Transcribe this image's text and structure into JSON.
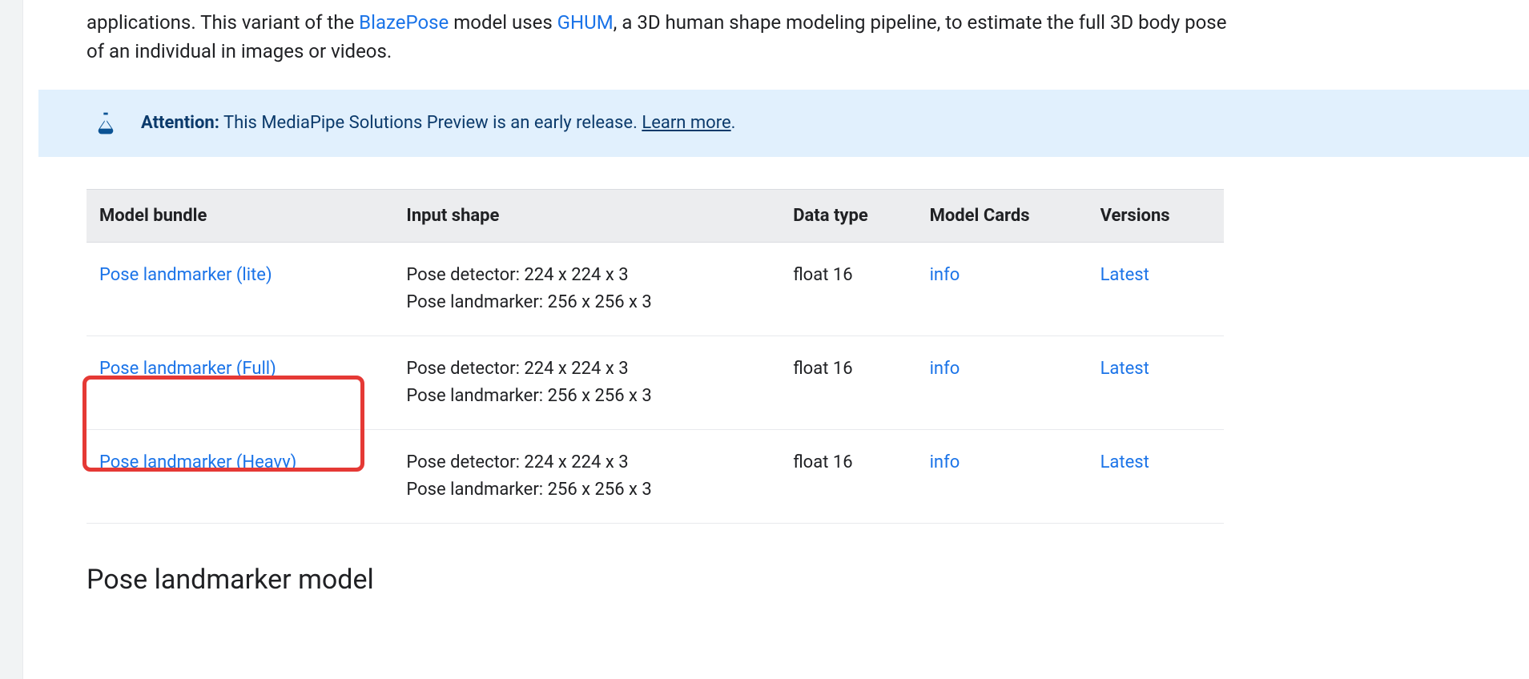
{
  "paragraph": {
    "seg1": "applications. This variant of the ",
    "link1": "BlazePose",
    "seg2": " model uses ",
    "link2": "GHUM",
    "seg3": ", a 3D human shape modeling pipeline, to estimate the full 3D body pose of an individual in images or videos."
  },
  "banner": {
    "label": "Attention:",
    "text": " This MediaPipe Solutions Preview is an early release. ",
    "learn_more": "Learn more",
    "period": "."
  },
  "table": {
    "headers": {
      "bundle": "Model bundle",
      "input_shape": "Input shape",
      "data_type": "Data type",
      "model_cards": "Model Cards",
      "versions": "Versions"
    },
    "rows": [
      {
        "bundle": "Pose landmarker (lite)",
        "shape_detector": "Pose detector: 224 x 224 x 3",
        "shape_landmarker": "Pose landmarker: 256 x 256 x 3",
        "dtype": "float 16",
        "card": "info",
        "version": "Latest"
      },
      {
        "bundle": "Pose landmarker (Full)",
        "shape_detector": "Pose detector: 224 x 224 x 3",
        "shape_landmarker": "Pose landmarker: 256 x 256 x 3",
        "dtype": "float 16",
        "card": "info",
        "version": "Latest"
      },
      {
        "bundle": "Pose landmarker (Heavy)",
        "shape_detector": "Pose detector: 224 x 224 x 3",
        "shape_landmarker": "Pose landmarker: 256 x 256 x 3",
        "dtype": "float 16",
        "card": "info",
        "version": "Latest"
      }
    ]
  },
  "section_heading": "Pose landmarker model"
}
